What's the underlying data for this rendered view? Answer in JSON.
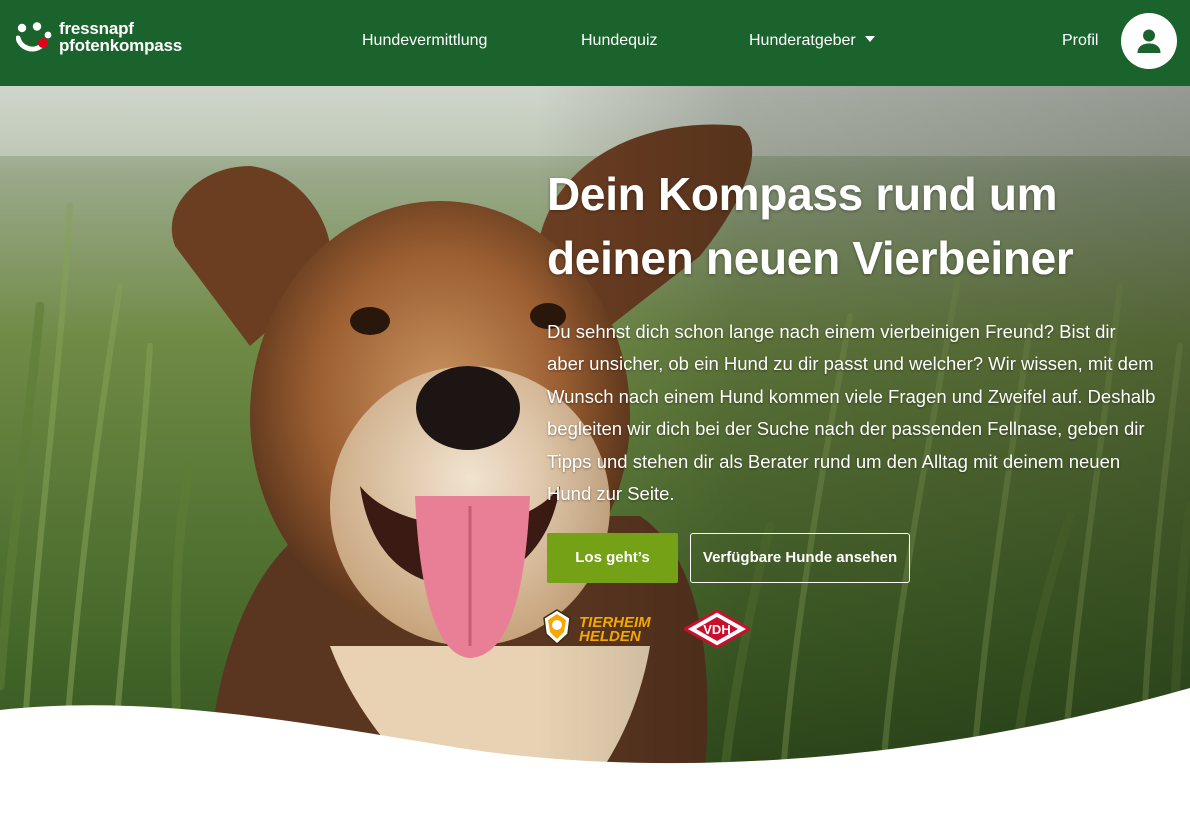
{
  "nav": {
    "logo": {
      "line1": "fressnapf",
      "line2": "pfotenkompass"
    },
    "links": [
      {
        "label": "Hundevermittlung"
      },
      {
        "label": "Hundequiz"
      },
      {
        "label": "Hunderatgeber"
      }
    ],
    "profile_label": "Profil"
  },
  "hero": {
    "title_line1": "Dein Kompass rund um",
    "title_line2": "deinen neuen Vierbeiner",
    "text": "Du sehnst dich schon lange nach einem vierbeinigen Freund? Bist dir aber unsicher, ob ein Hund zu dir passt und welcher? Wir wissen, mit dem Wunsch nach einem Hund kommen viele Fragen und Zweifel auf. Deshalb begleiten wir dich bei der Suche nach der passenden Fellnase, geben dir Tipps und stehen dir als Berater rund um den Alltag mit deinem neuen Hund zur Seite.",
    "cta_primary": "Los geht’s",
    "cta_secondary": "Verfügbare Hunde ansehen",
    "partners": {
      "tierheim_line1": "TIERHEIM",
      "tierheim_line2": "HELDEN",
      "vdh": "VDH"
    }
  },
  "colors": {
    "nav_bg": "#1b632c",
    "primary_button": "#74a116",
    "logo_accent": "#e2001a",
    "tierheim_gold": "#f5a800",
    "vdh_red": "#c8102e"
  },
  "icons": [
    "fressnapf-logo-icon",
    "user-icon",
    "chevron-down-icon",
    "tierheimhelden-logo-icon",
    "vdh-logo-icon"
  ]
}
